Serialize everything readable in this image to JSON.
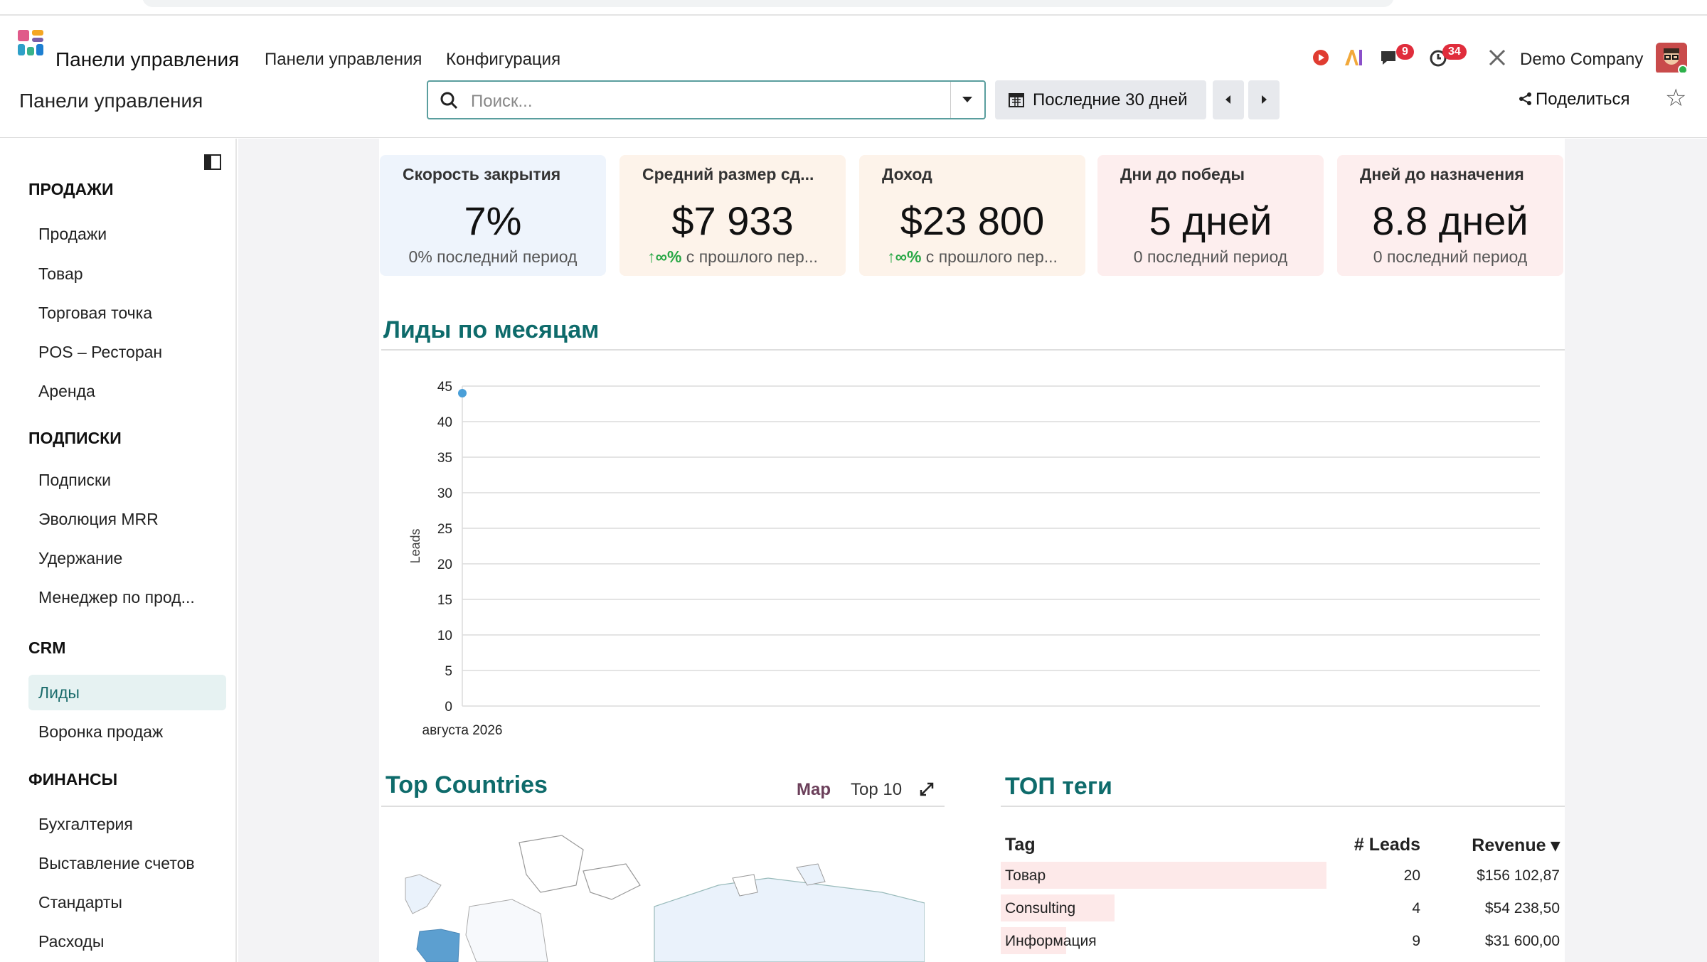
{
  "topbar": {
    "app_name": "Панели управления",
    "menu": [
      "Панели управления",
      "Конфигурация"
    ],
    "chat_badge": "9",
    "activity_badge": "34",
    "company": "Demo Company"
  },
  "control": {
    "page_title": "Панели управления",
    "search_placeholder": "Поиск...",
    "date_filter": "Последние 30 дней",
    "share_label": "Поделиться"
  },
  "sidebar": {
    "sections": [
      {
        "title": "ПРОДАЖИ",
        "items": [
          "Продажи",
          "Товар",
          "Торговая точка",
          "POS – Ресторан",
          "Аренда"
        ]
      },
      {
        "title": "ПОДПИСКИ",
        "items": [
          "Подписки",
          "Эволюция MRR",
          "Удержание",
          "Менеджер по прод..."
        ]
      },
      {
        "title": "CRM",
        "items": [
          "Лиды",
          "Воронка продаж"
        ]
      },
      {
        "title": "ФИНАНСЫ",
        "items": [
          "Бухгалтерия",
          "Выставление счетов",
          "Стандарты",
          "Расходы"
        ]
      }
    ],
    "active_item": "Лиды"
  },
  "kpis": [
    {
      "title": "Скорость закрытия",
      "value": "7%",
      "sub_arrow": "",
      "sub": "0% последний период",
      "bg": "#eef4fc"
    },
    {
      "title": "Средний размер сд...",
      "value": "$7 933",
      "sub_arrow": "↑∞%",
      "sub": " с прошлого пер...",
      "bg": "#fdf3ea"
    },
    {
      "title": "Доход",
      "value": "$23 800",
      "sub_arrow": "↑∞%",
      "sub": " с прошлого пер...",
      "bg": "#fdf3ea"
    },
    {
      "title": "Дни до победы",
      "value": "5 дней",
      "sub_arrow": "",
      "sub": "0 последний период",
      "bg": "#fdeeee"
    },
    {
      "title": "Дней до назначения",
      "value": "8.8 дней",
      "sub_arrow": "",
      "sub": "0 последний период",
      "bg": "#fdeeee"
    }
  ],
  "leads_chart_title": "Лиды по месяцам",
  "chart_data": {
    "type": "line",
    "x": [
      "августа 2026"
    ],
    "series": [
      {
        "values": [
          44
        ]
      }
    ],
    "ylabel": "Leads",
    "xlabel": "",
    "ylim": [
      0,
      45
    ],
    "yticks": [
      0,
      5,
      10,
      15,
      20,
      25,
      30,
      35,
      40,
      45
    ],
    "grid": true,
    "color": "#4a9fd8"
  },
  "countries": {
    "title": "Top Countries",
    "toggle_map": "Map",
    "toggle_top": "Top 10"
  },
  "tags": {
    "title": "ТОП теги",
    "headers": [
      "Tag",
      "# Leads",
      "Revenue ▾"
    ],
    "rows": [
      {
        "tag": "Товар",
        "leads": "20",
        "revenue": "$156 102,87",
        "share": 1.0
      },
      {
        "tag": "Consulting",
        "leads": "4",
        "revenue": "$54 238,50",
        "share": 0.35
      },
      {
        "tag": "Информация",
        "leads": "9",
        "revenue": "$31 600,00",
        "share": 0.2
      }
    ]
  }
}
